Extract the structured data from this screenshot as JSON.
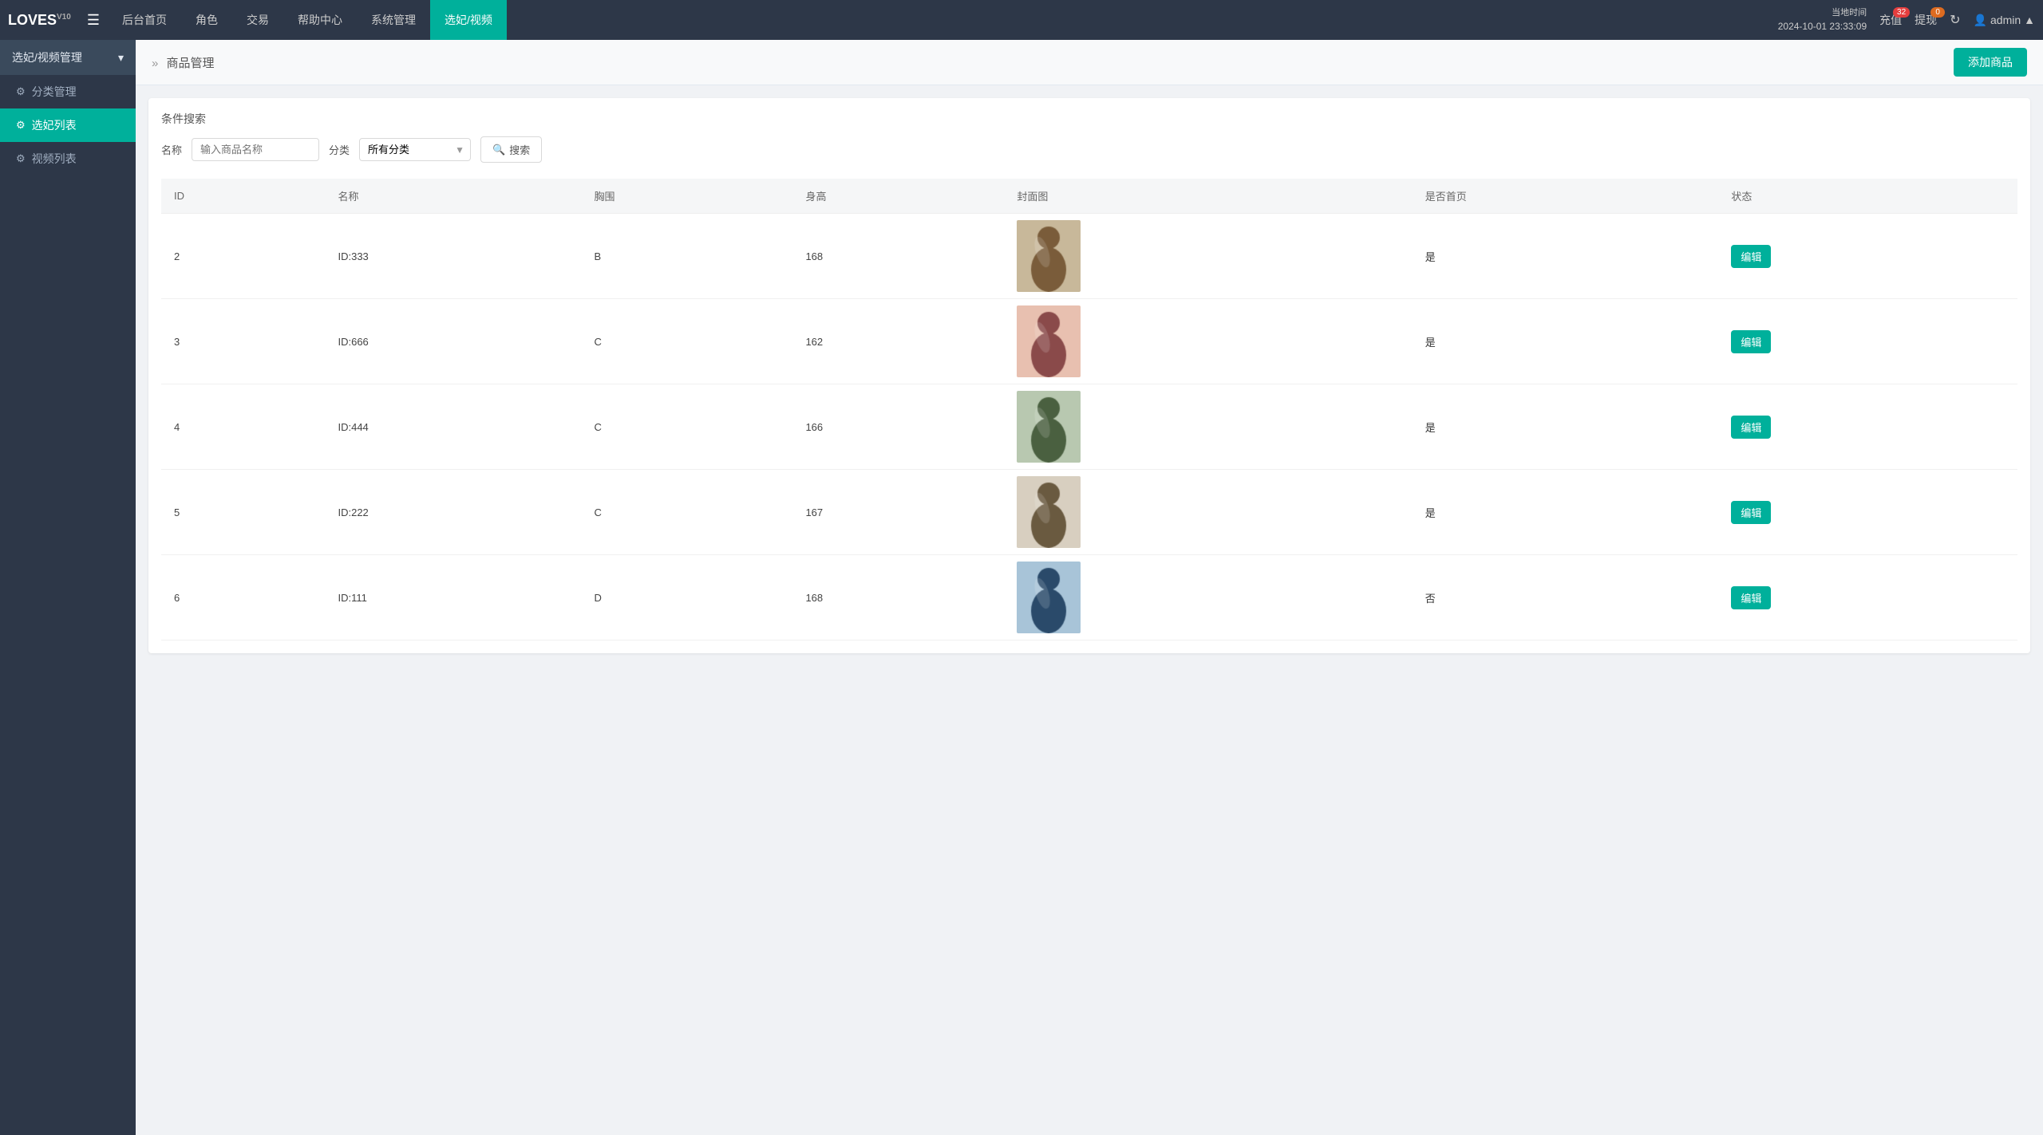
{
  "app": {
    "logo": "LOVES",
    "version": "V10"
  },
  "header": {
    "menu_icon": "☰",
    "nav_items": [
      {
        "label": "后台首页",
        "active": false
      },
      {
        "label": "角色",
        "active": false
      },
      {
        "label": "交易",
        "active": false
      },
      {
        "label": "帮助中心",
        "active": false
      },
      {
        "label": "系统管理",
        "active": false
      },
      {
        "label": "选妃/视频",
        "active": true
      }
    ],
    "time_label": "当地时间",
    "time_value": "2024-10-01 23:33:09",
    "recharge_label": "充值",
    "recharge_badge": "32",
    "withdraw_label": "提现",
    "withdraw_badge": "0",
    "refresh_icon": "↻",
    "user_label": "admin",
    "user_icon": "▲"
  },
  "sidebar": {
    "group_label": "选妃/视频管理",
    "group_arrow": "▾",
    "items": [
      {
        "label": "分类管理",
        "active": false,
        "icon": "⚙"
      },
      {
        "label": "选妃列表",
        "active": true,
        "icon": "⚙"
      },
      {
        "label": "视频列表",
        "active": false,
        "icon": "⚙"
      }
    ]
  },
  "breadcrumb": {
    "arrow": "»",
    "text": "商品管理"
  },
  "add_button_label": "添加商品",
  "search": {
    "title": "条件搜索",
    "name_label": "名称",
    "name_placeholder": "输入商品名称",
    "category_label": "分类",
    "category_placeholder": "所有分类",
    "search_button_label": "搜索",
    "search_icon": "🔍"
  },
  "table": {
    "headers": [
      "ID",
      "名称",
      "胸围",
      "身高",
      "封面图",
      "是否首页",
      "状态"
    ],
    "rows": [
      {
        "id": "2",
        "name": "ID:333",
        "chest": "B",
        "height": "168",
        "is_homepage": "是",
        "status_label": "编辑",
        "img_color": "#c8a882",
        "img_label": "girl1"
      },
      {
        "id": "3",
        "name": "ID:666",
        "chest": "C",
        "height": "162",
        "is_homepage": "是",
        "status_label": "编辑",
        "img_color": "#d4a0a0",
        "img_label": "girl2"
      },
      {
        "id": "4",
        "name": "ID:444",
        "chest": "C",
        "height": "166",
        "is_homepage": "是",
        "status_label": "编辑",
        "img_color": "#b0b8a8",
        "img_label": "girl3"
      },
      {
        "id": "5",
        "name": "ID:222",
        "chest": "C",
        "height": "167",
        "is_homepage": "是",
        "status_label": "编辑",
        "img_color": "#d8cfc0",
        "img_label": "girl4"
      },
      {
        "id": "6",
        "name": "ID:111",
        "chest": "D",
        "height": "168",
        "is_homepage": "否",
        "status_label": "编辑",
        "img_color": "#a8c4d8",
        "img_label": "girl5"
      }
    ]
  }
}
